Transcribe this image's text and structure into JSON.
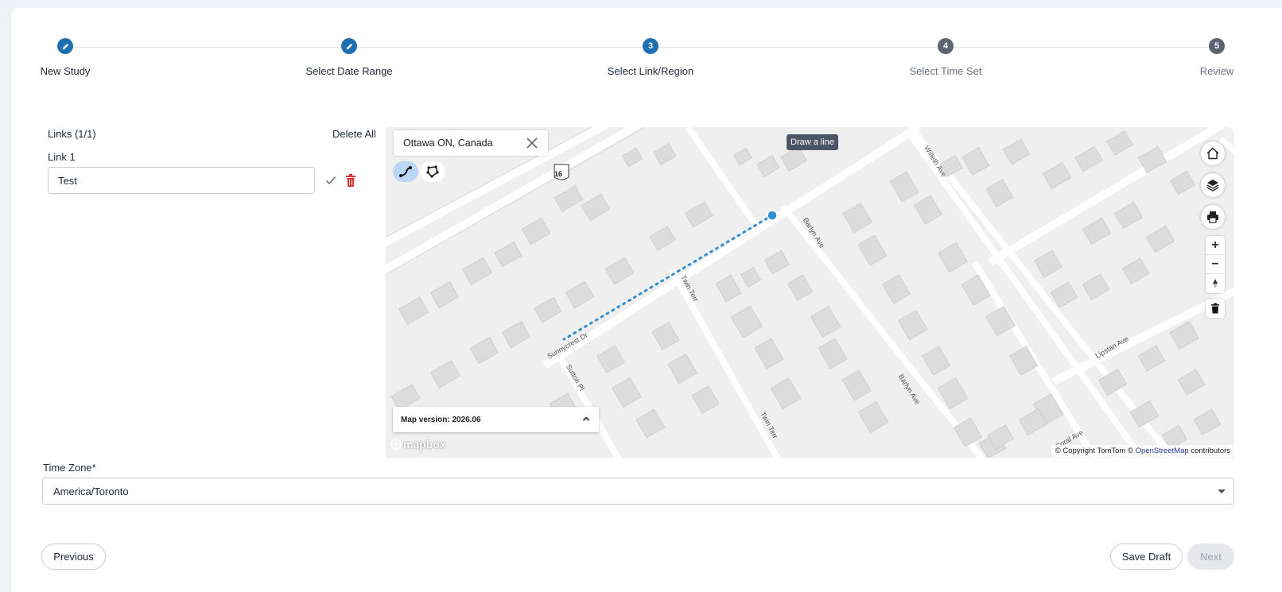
{
  "stepper": {
    "steps": [
      {
        "label": "New Study",
        "marker": "",
        "state": "done"
      },
      {
        "label": "Select Date Range",
        "marker": "",
        "state": "done"
      },
      {
        "label": "Select Link/Region",
        "marker": "3",
        "state": "active"
      },
      {
        "label": "Select Time Set",
        "marker": "4",
        "state": "todo"
      },
      {
        "label": "Review",
        "marker": "5",
        "state": "todo"
      }
    ]
  },
  "links": {
    "header": "Links (1/1)",
    "delete_all": "Delete All",
    "items": [
      {
        "label": "Link 1",
        "value": "Test"
      }
    ]
  },
  "map": {
    "search_value": "Ottawa ON, Canada",
    "tooltip": "Draw a line",
    "route_shield": "16",
    "version_label": "Map version: 2026.06",
    "logo_text": "mapbox",
    "attribution_prefix": "© Copyright TomTom ©",
    "attribution_link": "OpenStreetMap",
    "attribution_suffix": "contributors",
    "streets": {
      "willeth": "Willeth Ave",
      "barlyn1": "Barlyn Ave",
      "barlyn2": "Barlyn Ave",
      "twin1": "Twin Terr",
      "twin2": "Twin Terr",
      "sunnycrest": "Sunnycrest Dr",
      "sutton": "Sutton Pl",
      "lipstan": "Lipstan Ave",
      "coral": "Coral Ave"
    },
    "icons": [
      "home-icon",
      "layers-icon",
      "print-icon",
      "zoom-in-icon",
      "zoom-out-icon",
      "compass-icon",
      "trash-icon",
      "line-draw-icon",
      "polygon-draw-icon"
    ]
  },
  "timezone": {
    "label": "Time Zone*",
    "value": "America/Toronto"
  },
  "footer": {
    "previous": "Previous",
    "save_draft": "Save Draft",
    "next": "Next"
  },
  "colors": {
    "primary": "#1f6fb3",
    "danger": "#d93030",
    "route": "#2f8fd0"
  }
}
